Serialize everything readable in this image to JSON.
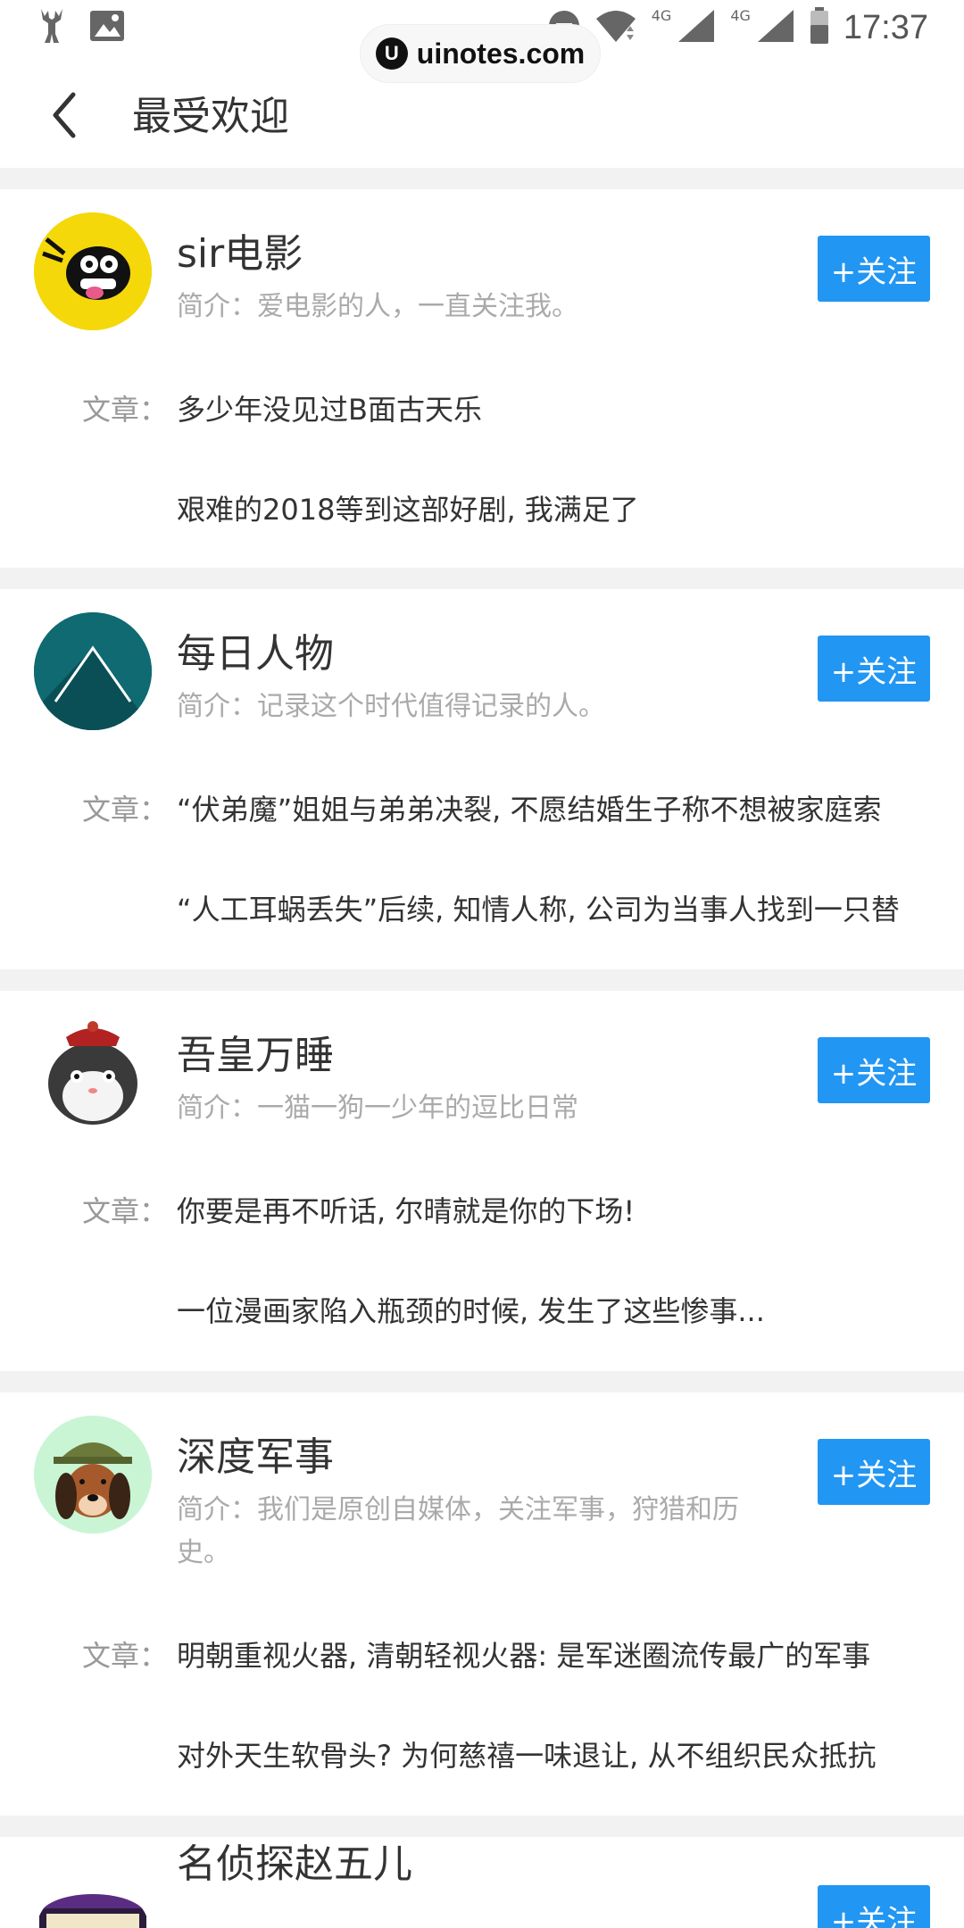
{
  "status_bar": {
    "time": "17:37",
    "network_1": "4G",
    "network_2": "4G"
  },
  "watermark": {
    "logo_letter": "U",
    "text": "uinotes.com"
  },
  "header": {
    "title": "最受欢迎"
  },
  "accounts": [
    {
      "name": "sir电影",
      "intro": "简介：爱电影的人，一直关注我。",
      "follow_label": "+关注",
      "articles_label": "文章：",
      "articles": [
        "多少年没见过B面古天乐",
        "艰难的2018等到这部好剧, 我满足了"
      ]
    },
    {
      "name": "每日人物",
      "intro": "简介：记录这个时代值得记录的人。",
      "follow_label": "+关注",
      "articles_label": "文章：",
      "articles": [
        "“伏弟魔”姐姐与弟弟决裂, 不愿结婚生子称不想被家庭索",
        "“人工耳蜗丢失”后续, 知情人称, 公司为当事人找到一只替"
      ]
    },
    {
      "name": "吾皇万睡",
      "intro": "简介：一猫一狗一少年的逗比日常",
      "follow_label": "+关注",
      "articles_label": "文章：",
      "articles": [
        "你要是再不听话, 尔晴就是你的下场!",
        "一位漫画家陷入瓶颈的时候, 发生了这些惨事..."
      ]
    },
    {
      "name": "深度军事",
      "intro": "简介：我们是原创自媒体，关注军事，狩猎和历史。",
      "follow_label": "+关注",
      "articles_label": "文章：",
      "articles": [
        "明朝重视火器, 清朝轻视火器: 是军迷圈流传最广的军事",
        "对外天生软骨头? 为何慈禧一味退让, 从不组织民众抵抗"
      ]
    },
    {
      "name": "名侦探赵五儿",
      "follow_label": "+关注"
    }
  ],
  "colors": {
    "accent": "#2196f3",
    "separator": "#f2f2f2",
    "muted_text": "#aaaaaa"
  }
}
